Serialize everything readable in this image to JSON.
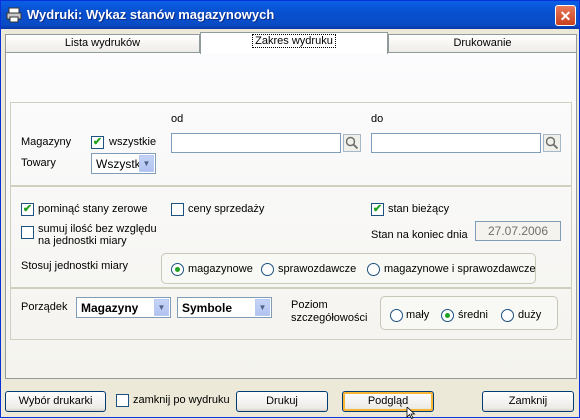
{
  "window": {
    "title": "Wydruki: Wykaz stanów magazynowych",
    "close": "✕"
  },
  "tabs": [
    {
      "label": "Lista wydruków"
    },
    {
      "label": "Zakres wydruku"
    },
    {
      "label": "Drukowanie"
    }
  ],
  "range": {
    "od_label": "od",
    "do_label": "do",
    "magazyny_label": "Magazyny",
    "wszystkie_label": "wszystkie",
    "towary_label": "Towary",
    "towary_value": "Wszystk",
    "od_value": "",
    "do_value": ""
  },
  "options": {
    "pominac_label": "pominąć stany zerowe",
    "sumuj_label_1": "sumuj ilość bez względu",
    "sumuj_label_2": "na jednostki miary",
    "ceny_label": "ceny sprzedaży",
    "stan_biezacy_label": "stan bieżący",
    "stan_na_koniec_label": "Stan na koniec dnia",
    "date_value": "27.07.2006",
    "jednostki_label": "Stosuj jednostki miary",
    "jednostki_options": [
      "magazynowe",
      "sprawozdawcze",
      "magazynowe i sprawozdawcze"
    ]
  },
  "order": {
    "porzadek_label": "Porządek",
    "sort1": "Magazyny",
    "sort2": "Symbole",
    "poziom_label_1": "Poziom",
    "poziom_label_2": "szczegółowości",
    "poziom_options": [
      "mały",
      "średni",
      "duży"
    ]
  },
  "footer": {
    "wybor_drukarki": "Wybór drukarki",
    "zamknij_po": "zamknij po wydruku",
    "drukuj": "Drukuj",
    "podglad": "Podgląd",
    "zamknij": "Zamknij"
  },
  "colors": {
    "titlebar": "#0A5FE5",
    "check": "#21A121",
    "window_bg": "#ECE9D8"
  }
}
